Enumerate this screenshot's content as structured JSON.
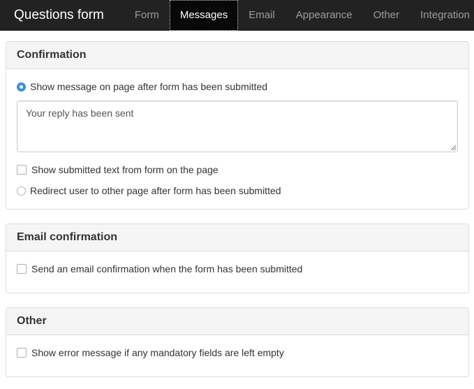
{
  "navbar": {
    "brand": "Questions form",
    "tabs": [
      {
        "label": "Form"
      },
      {
        "label": "Messages",
        "active": true
      },
      {
        "label": "Email"
      },
      {
        "label": "Appearance"
      },
      {
        "label": "Other"
      },
      {
        "label": "Integration"
      }
    ]
  },
  "confirmation": {
    "title": "Confirmation",
    "show_message_label": "Show message on page after form has been submitted",
    "message_value": "Your reply has been sent",
    "show_submitted_label": "Show submitted text from form on the page",
    "redirect_label": "Redirect user to other page after form has been submitted"
  },
  "email_confirmation": {
    "title": "Email confirmation",
    "send_label": "Send an email confirmation when the form has been submitted"
  },
  "other": {
    "title": "Other",
    "error_label": "Show error message if any mandatory fields are left empty"
  },
  "colors": {
    "navbar_bg": "#222222",
    "accent": "#3b8de0"
  }
}
